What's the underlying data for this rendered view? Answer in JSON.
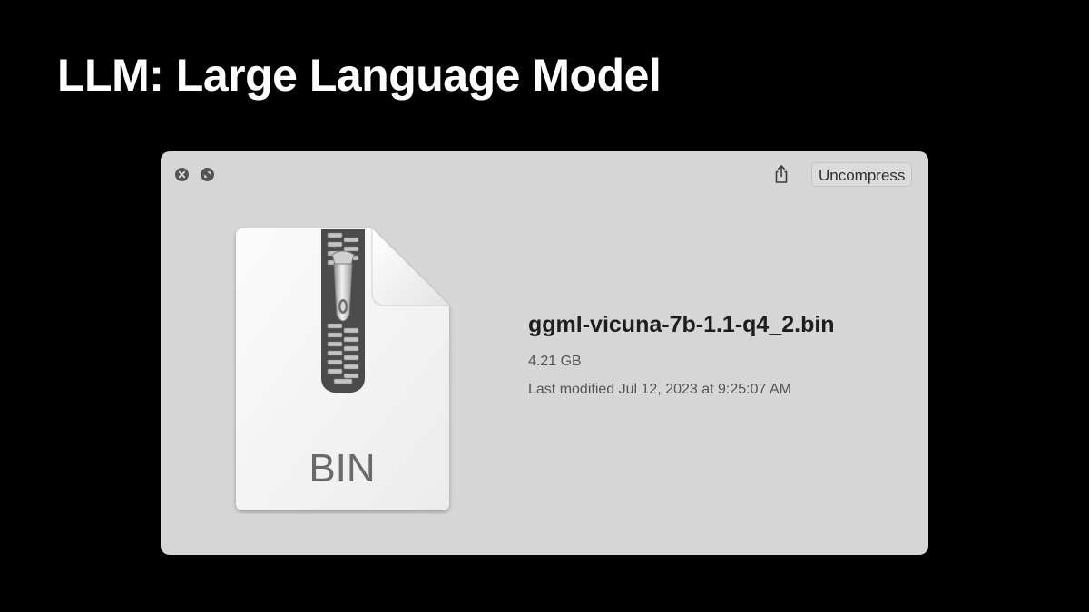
{
  "slide": {
    "title": "LLM: Large Language Model"
  },
  "quicklook": {
    "toolbar": {
      "close_icon": "close-icon",
      "fullscreen_icon": "fullscreen-icon",
      "share_icon": "share-icon",
      "uncompress_label": "Uncompress"
    },
    "file": {
      "icon": "zip-archive-icon",
      "type_label": "BIN",
      "name": "ggml-vicuna-7b-1.1-q4_2.bin",
      "size": "4.21 GB",
      "modified": "Last modified Jul 12, 2023 at 9:25:07 AM"
    }
  },
  "colors": {
    "background": "#000000",
    "window": "#d6d6d6",
    "title": "#ffffff",
    "filename": "#1e1e1e",
    "meta": "#555555"
  }
}
